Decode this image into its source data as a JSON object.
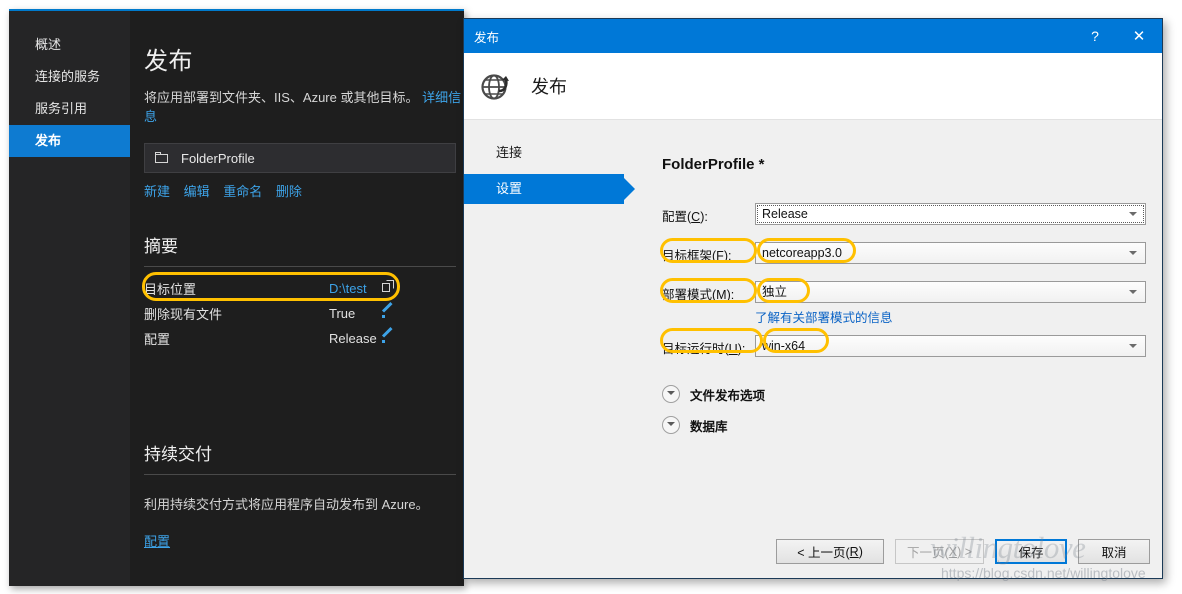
{
  "vs_window": {
    "sidebar": {
      "items": [
        {
          "label": "概述",
          "selected": false
        },
        {
          "label": "连接的服务",
          "selected": false
        },
        {
          "label": "服务引用",
          "selected": false
        },
        {
          "label": "发布",
          "selected": true
        }
      ]
    },
    "page_title": "发布",
    "page_subtitle": "将应用部署到文件夹、IIS、Azure 或其他目标。",
    "page_subtitle_link": "详细信息",
    "profile": {
      "icon": "folder-icon",
      "name": "FolderProfile",
      "actions": [
        "新建",
        "编辑",
        "重命名",
        "删除"
      ]
    },
    "summary": {
      "heading": "摘要",
      "rows": [
        {
          "key": "目标位置",
          "value": "D:\\test",
          "value_style": "link",
          "icon": "copy-icon",
          "highlighted": true
        },
        {
          "key": "删除现有文件",
          "value": "True",
          "value_style": "plain",
          "icon": "pencil-icon",
          "highlighted": false
        },
        {
          "key": "配置",
          "value": "Release",
          "value_style": "plain",
          "icon": "pencil-icon",
          "highlighted": false
        }
      ]
    },
    "continuous_delivery": {
      "heading": "持续交付",
      "note": "利用持续交付方式将应用程序自动发布到 Azure。",
      "link": "配置"
    }
  },
  "dialog": {
    "titlebar": {
      "title": "发布",
      "help_glyph": "?",
      "close_glyph": "✕"
    },
    "header": {
      "icon": "globe-publish-icon",
      "title": "发布"
    },
    "nav": [
      {
        "label": "连接",
        "selected": false
      },
      {
        "label": "设置",
        "selected": true
      }
    ],
    "form": {
      "profile_name": "FolderProfile *",
      "fields": [
        {
          "label_prefix": "配置(",
          "accel": "C",
          "label_suffix": "):",
          "value": "Release",
          "focused": true,
          "highlight_label": false,
          "highlight_value": false
        },
        {
          "label_prefix": "目标框架(",
          "accel": "F",
          "label_suffix": "):",
          "value": "netcoreapp3.0",
          "focused": false,
          "highlight_label": true,
          "highlight_value": true
        },
        {
          "label_prefix": "部署模式(",
          "accel": "M",
          "label_suffix": "):",
          "value": "独立",
          "focused": false,
          "highlight_label": true,
          "highlight_value": true
        },
        {
          "label_prefix": "目标运行时(",
          "accel": "U",
          "label_suffix": "):",
          "value": "win-x64",
          "focused": false,
          "highlight_label": true,
          "highlight_value": true
        }
      ],
      "deploy_mode_link": "了解有关部署模式的信息",
      "expanders": [
        {
          "label": "文件发布选项",
          "icon": "chevron-down-icon",
          "expanded": false
        },
        {
          "label": "数据库",
          "icon": "chevron-down-icon",
          "expanded": false
        }
      ]
    },
    "buttons": [
      {
        "prefix": "< 上一页(",
        "accel": "R",
        "suffix": ")",
        "state": "normal",
        "wide": true
      },
      {
        "prefix": "下一页(",
        "accel": "X",
        "suffix": ") >",
        "state": "disabled",
        "wide": false
      },
      {
        "prefix": "保存",
        "accel": "",
        "suffix": "",
        "state": "default",
        "wide": false
      },
      {
        "prefix": "取消",
        "accel": "",
        "suffix": "",
        "state": "normal",
        "wide": false
      }
    ]
  },
  "watermark": {
    "script": "willingtolove",
    "url": "https://blog.csdn.net/willingtolove"
  },
  "colors": {
    "vs_accent": "#0e7bd1",
    "vs_link": "#3da3e8",
    "vs_bg_dark": "#1e1e1e",
    "vs_sidebar_bg": "#252526",
    "dialog_accent": "#0078d7",
    "dialog_bg": "#f0f0f0",
    "highlight_yellow": "#ffc000"
  }
}
